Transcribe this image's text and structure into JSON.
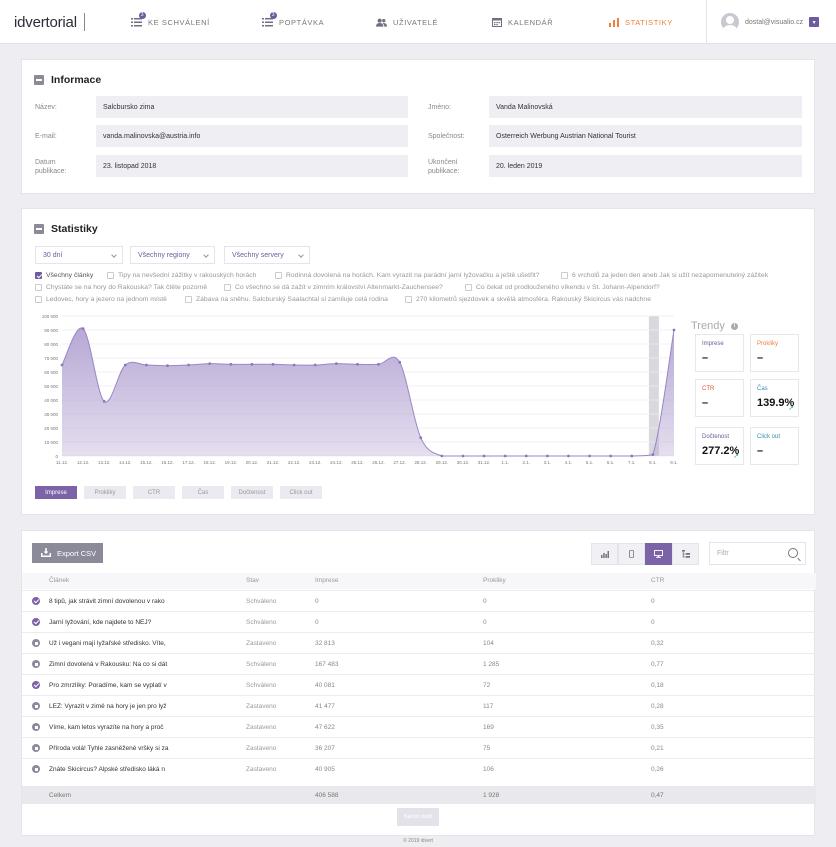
{
  "header": {
    "logo": "idvertorial",
    "nav": [
      {
        "label": "Ke schválení",
        "icon": "list-icon",
        "badge": "3",
        "active": false
      },
      {
        "label": "Poptávka",
        "icon": "list-icon",
        "badge": "3",
        "active": false
      },
      {
        "label": "Uživatelé",
        "icon": "users-icon",
        "badge": "",
        "active": false
      },
      {
        "label": "Kalendář",
        "icon": "calendar-icon",
        "badge": "",
        "active": false
      },
      {
        "label": "Statistiky",
        "icon": "chart-icon",
        "badge": "",
        "active": true
      }
    ],
    "user_email": "dostal@visualio.cz"
  },
  "info": {
    "title": "Informace",
    "fields": [
      {
        "label": "Název:",
        "value": "Salcbursko zima"
      },
      {
        "label": "Jméno:",
        "value": "Vanda Malinovská"
      },
      {
        "label": "E-mail:",
        "value": "vanda.malinovska@austria.info"
      },
      {
        "label": "Společnost:",
        "value": "Osterreich Werbung Austrian National Tourist"
      },
      {
        "label": "Datum publikace:",
        "value": "23. listopad 2018"
      },
      {
        "label": "Ukončení publikace:",
        "value": "20. leden 2019"
      }
    ]
  },
  "stats": {
    "title": "Statistiky",
    "filters": [
      "30 dní",
      "Všechny regiony",
      "Všechny servery"
    ],
    "articles": [
      {
        "label": "Všechny články",
        "checked": true
      },
      {
        "label": "Tipy na nevšední zážitky v rakouských horách",
        "checked": false
      },
      {
        "label": "Rodinná dovolená na horách. Kam vyrazit na parádní jarní lyžovačku a ještě ušetřit?",
        "checked": false
      },
      {
        "label": "6 vrcholů za jeden den aneb Jak si užít nezapomenutelný zážitek",
        "checked": false
      },
      {
        "label": "Chystáte se na hory do Rakouska? Tak čtěte pozorně",
        "checked": false
      },
      {
        "label": "Co všechno se dá zažít v zimním království Altenmarkt-Zauchensee?",
        "checked": false
      },
      {
        "label": "Co čekat od prodlouženého víkendu v St. Johann-Alpendorf?",
        "checked": false
      },
      {
        "label": "Ledovec, hory a jezero na jednom místě",
        "checked": false
      },
      {
        "label": "Zábava na sněhu. Salcburský Saalachtal si zamiluje celá rodina",
        "checked": false
      },
      {
        "label": "270 kilometrů sjezdovek a skvělá atmosféra. Rakouský Skicircus vás nadchne",
        "checked": false
      }
    ],
    "metric_buttons": [
      {
        "label": "Imprese",
        "active": true
      },
      {
        "label": "Prokliky",
        "active": false
      },
      {
        "label": "CTR",
        "active": false
      },
      {
        "label": "Čas",
        "active": false
      },
      {
        "label": "Dočtenost",
        "active": false
      },
      {
        "label": "Click out",
        "active": false
      }
    ],
    "trends_title": "Trendy",
    "trend_tiles": [
      {
        "label": "Imprese",
        "value": "–",
        "color": "#6f5a9f",
        "up": false
      },
      {
        "label": "Prokliky",
        "value": "–",
        "color": "#f07f3c",
        "up": false
      },
      {
        "label": "CTR",
        "value": "–",
        "color": "#e0533c",
        "up": false
      },
      {
        "label": "Čas",
        "value": "139.9%",
        "color": "#3a8fb0",
        "up": true
      },
      {
        "label": "Dočtenost",
        "value": "277.2%",
        "color": "#6f5a9f",
        "up": true
      },
      {
        "label": "Click out",
        "value": "–",
        "color": "#3a8fb0",
        "up": false
      }
    ]
  },
  "chart_data": {
    "type": "area",
    "x": [
      "11.12.",
      "12.12.",
      "13.12.",
      "14.12.",
      "15.12.",
      "16.12.",
      "17.12.",
      "18.12.",
      "19.12.",
      "20.12.",
      "21.12.",
      "22.12.",
      "23.12.",
      "24.12.",
      "25.12.",
      "26.12.",
      "27.12.",
      "28.12.",
      "29.12.",
      "30.12.",
      "31.12.",
      "1.1.",
      "2.1.",
      "3.1.",
      "4.1.",
      "5.1.",
      "6.1.",
      "7.1.",
      "8.1.",
      "9.1."
    ],
    "y_ticks": [
      "0",
      "10 000",
      "20 000",
      "30 000",
      "40 000",
      "50 000",
      "60 000",
      "70 000",
      "80 000",
      "90 000",
      "100 000"
    ],
    "ylim": [
      0,
      100000
    ],
    "series": [
      {
        "values": [
          65000,
          91000,
          39000,
          65000,
          65000,
          64500,
          65000,
          66000,
          65500,
          65500,
          65500,
          65000,
          65000,
          66000,
          65500,
          65500,
          67000,
          13000,
          0,
          0,
          0,
          0,
          0,
          0,
          0,
          0,
          0,
          0,
          1000,
          90000
        ],
        "color": "#b3a3d2"
      }
    ],
    "grid": true
  },
  "table": {
    "export_label": "Export CSV",
    "view_icons": [
      "bar-chart-icon",
      "mobile-icon",
      "desktop-icon",
      "tree-icon"
    ],
    "filter_placeholder": "Filtr",
    "columns": [
      "Článek",
      "Stav",
      "Imprese",
      "Prokliky",
      "CTR"
    ],
    "rows": [
      {
        "status": "ok",
        "article": "8 tipů, jak strávit zimní dovolenou v rako",
        "state": "Schváleno",
        "impressions": "0",
        "clicks": "0",
        "ctr": "0"
      },
      {
        "status": "ok",
        "article": "Jarní lyžování, kde najdete to NEJ?",
        "state": "Schváleno",
        "impressions": "0",
        "clicks": "0",
        "ctr": "0"
      },
      {
        "status": "stop",
        "article": "Už i vegani mají lyžařské středisko. Víte,",
        "state": "Zastaveno",
        "impressions": "32 813",
        "clicks": "104",
        "ctr": "0,32"
      },
      {
        "status": "stop",
        "article": "Zimní dovolená v Rakousku: Na co si dát",
        "state": "Schváleno",
        "impressions": "167 483",
        "clicks": "1 285",
        "ctr": "0,77"
      },
      {
        "status": "ok",
        "article": "Pro zmrzlíky: Poradíme, kam se vyplatí v",
        "state": "Schváleno",
        "impressions": "40 081",
        "clicks": "72",
        "ctr": "0,18"
      },
      {
        "status": "stop",
        "article": "LEŽ: Vyrazit v zimě na hory je jen pro lyž",
        "state": "Zastaveno",
        "impressions": "41 477",
        "clicks": "117",
        "ctr": "0,28"
      },
      {
        "status": "stop",
        "article": "Víme, kam letos vyrazíte na hory a proč",
        "state": "Zastaveno",
        "impressions": "47 622",
        "clicks": "169",
        "ctr": "0,35"
      },
      {
        "status": "stop",
        "article": "Příroda volá! Tyhle zasněžené vršky si za",
        "state": "Zastaveno",
        "impressions": "36 207",
        "clicks": "75",
        "ctr": "0,21"
      },
      {
        "status": "stop",
        "article": "Znáte Skicircus? Alpské středisko láká n",
        "state": "Zastaveno",
        "impressions": "40 905",
        "clicks": "106",
        "ctr": "0,26"
      }
    ],
    "total": {
      "label": "Celkem",
      "impressions": "406 588",
      "clicks": "1 928",
      "ctr": "0,47"
    },
    "more_label": "Načíst další"
  },
  "footer": "© 2019 idvert"
}
